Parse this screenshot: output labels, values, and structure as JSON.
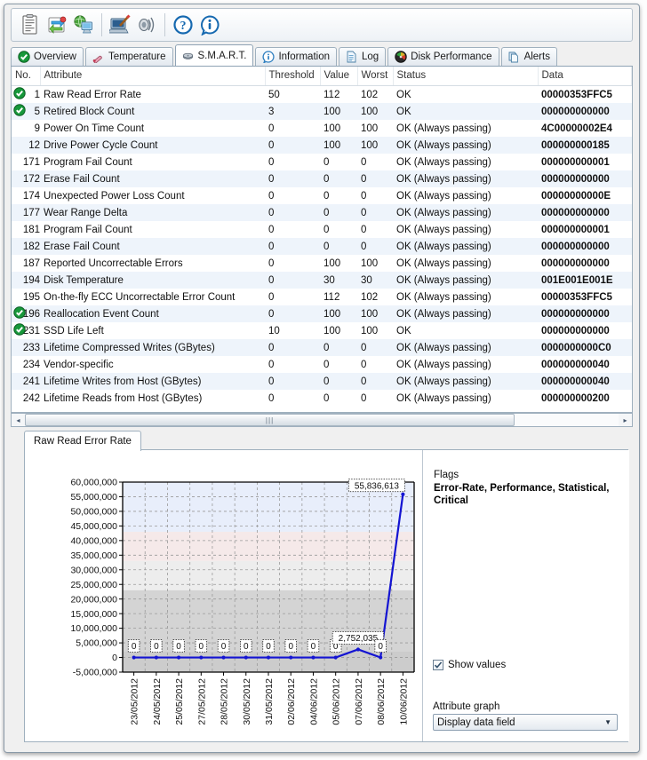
{
  "toolbar": {
    "buttons": [
      {
        "name": "report-icon",
        "title": "Report"
      },
      {
        "name": "refresh-icon",
        "title": "Refresh"
      },
      {
        "name": "network-globe-icon",
        "title": "Network"
      },
      {
        "name": "configure-disk-icon",
        "title": "Configure"
      },
      {
        "name": "sound-icon",
        "title": "Sound"
      },
      {
        "name": "help-icon",
        "title": "Help"
      },
      {
        "name": "about-info-icon",
        "title": "Information"
      }
    ]
  },
  "tabs": [
    {
      "label": "Overview",
      "icon": "green-check-icon",
      "active": false
    },
    {
      "label": "Temperature",
      "icon": "thermometer-icon",
      "active": false
    },
    {
      "label": "S.M.A.R.T.",
      "icon": "smart-chip-icon",
      "active": true
    },
    {
      "label": "Information",
      "icon": "info-icon",
      "active": false
    },
    {
      "label": "Log",
      "icon": "document-icon",
      "active": false
    },
    {
      "label": "Disk Performance",
      "icon": "gauge-icon",
      "active": false
    },
    {
      "label": "Alerts",
      "icon": "pages-icon",
      "active": false
    }
  ],
  "table": {
    "columns": [
      "No.",
      "Attribute",
      "Threshold",
      "Value",
      "Worst",
      "Status",
      "Data"
    ],
    "rows": [
      {
        "check": true,
        "no": "1",
        "attribute": "Raw Read Error Rate",
        "threshold": "50",
        "value": "112",
        "worst": "102",
        "status": "OK",
        "data": "00000353FFC5"
      },
      {
        "check": true,
        "no": "5",
        "attribute": "Retired Block Count",
        "threshold": "3",
        "value": "100",
        "worst": "100",
        "status": "OK",
        "data": "000000000000"
      },
      {
        "check": false,
        "no": "9",
        "attribute": "Power On Time Count",
        "threshold": "0",
        "value": "100",
        "worst": "100",
        "status": "OK (Always passing)",
        "data": "4C00000002E4"
      },
      {
        "check": false,
        "no": "12",
        "attribute": "Drive Power Cycle Count",
        "threshold": "0",
        "value": "100",
        "worst": "100",
        "status": "OK (Always passing)",
        "data": "000000000185"
      },
      {
        "check": false,
        "no": "171",
        "attribute": "Program Fail Count",
        "threshold": "0",
        "value": "0",
        "worst": "0",
        "status": "OK (Always passing)",
        "data": "000000000001"
      },
      {
        "check": false,
        "no": "172",
        "attribute": "Erase Fail Count",
        "threshold": "0",
        "value": "0",
        "worst": "0",
        "status": "OK (Always passing)",
        "data": "000000000000"
      },
      {
        "check": false,
        "no": "174",
        "attribute": "Unexpected Power Loss Count",
        "threshold": "0",
        "value": "0",
        "worst": "0",
        "status": "OK (Always passing)",
        "data": "00000000000E"
      },
      {
        "check": false,
        "no": "177",
        "attribute": "Wear Range Delta",
        "threshold": "0",
        "value": "0",
        "worst": "0",
        "status": "OK (Always passing)",
        "data": "000000000000"
      },
      {
        "check": false,
        "no": "181",
        "attribute": "Program Fail Count",
        "threshold": "0",
        "value": "0",
        "worst": "0",
        "status": "OK (Always passing)",
        "data": "000000000001"
      },
      {
        "check": false,
        "no": "182",
        "attribute": "Erase Fail Count",
        "threshold": "0",
        "value": "0",
        "worst": "0",
        "status": "OK (Always passing)",
        "data": "000000000000"
      },
      {
        "check": false,
        "no": "187",
        "attribute": "Reported Uncorrectable Errors",
        "threshold": "0",
        "value": "100",
        "worst": "100",
        "status": "OK (Always passing)",
        "data": "000000000000"
      },
      {
        "check": false,
        "no": "194",
        "attribute": "Disk Temperature",
        "threshold": "0",
        "value": "30",
        "worst": "30",
        "status": "OK (Always passing)",
        "data": "001E001E001E"
      },
      {
        "check": false,
        "no": "195",
        "attribute": "On-the-fly ECC Uncorrectable Error Count",
        "threshold": "0",
        "value": "112",
        "worst": "102",
        "status": "OK (Always passing)",
        "data": "00000353FFC5"
      },
      {
        "check": true,
        "no": "196",
        "attribute": "Reallocation Event Count",
        "threshold": "0",
        "value": "100",
        "worst": "100",
        "status": "OK (Always passing)",
        "data": "000000000000"
      },
      {
        "check": true,
        "no": "231",
        "attribute": "SSD Life Left",
        "threshold": "10",
        "value": "100",
        "worst": "100",
        "status": "OK",
        "data": "000000000000"
      },
      {
        "check": false,
        "no": "233",
        "attribute": "Lifetime Compressed Writes (GBytes)",
        "threshold": "0",
        "value": "0",
        "worst": "0",
        "status": "OK (Always passing)",
        "data": "0000000000C0"
      },
      {
        "check": false,
        "no": "234",
        "attribute": "Vendor-specific",
        "threshold": "0",
        "value": "0",
        "worst": "0",
        "status": "OK (Always passing)",
        "data": "000000000040"
      },
      {
        "check": false,
        "no": "241",
        "attribute": "Lifetime Writes from Host (GBytes)",
        "threshold": "0",
        "value": "0",
        "worst": "0",
        "status": "OK (Always passing)",
        "data": "000000000040"
      },
      {
        "check": false,
        "no": "242",
        "attribute": "Lifetime Reads from Host (GBytes)",
        "threshold": "0",
        "value": "0",
        "worst": "0",
        "status": "OK (Always passing)",
        "data": "000000000200"
      }
    ]
  },
  "scrollbar": {
    "left_arrow": "◂",
    "right_arrow": "▸",
    "grip": "|||"
  },
  "graph_panel": {
    "tab_label": "Raw Read Error Rate",
    "flags_label": "Flags",
    "flags_value": "Error-Rate, Performance, Statistical, Critical",
    "show_values_label": "Show values",
    "show_values_checked": true,
    "attribute_graph_label": "Attribute graph",
    "select_value": "Display data field",
    "select_arrow": "▼"
  },
  "chart_data": {
    "type": "line",
    "title": "Raw Read Error Rate",
    "xlabel": "",
    "ylabel": "",
    "grid": true,
    "legend": "none",
    "line_color": "#1414d2",
    "ylim": [
      -5000000,
      60000000
    ],
    "yticks": [
      60000000,
      55000000,
      50000000,
      45000000,
      40000000,
      35000000,
      30000000,
      25000000,
      20000000,
      15000000,
      10000000,
      5000000,
      0,
      -5000000
    ],
    "ytick_labels": [
      "60,000,000",
      "55,000,000",
      "50,000,000",
      "45,000,000",
      "40,000,000",
      "35,000,000",
      "30,000,000",
      "25,000,000",
      "20,000,000",
      "15,000,000",
      "10,000,000",
      "5,000,000",
      "0",
      "-5,000,000"
    ],
    "categories": [
      "23/05/2012",
      "24/05/2012",
      "25/05/2012",
      "27/05/2012",
      "28/05/2012",
      "30/05/2012",
      "31/05/2012",
      "02/06/2012",
      "04/06/2012",
      "05/06/2012",
      "07/06/2012",
      "08/06/2012",
      "10/06/2012"
    ],
    "values": [
      0,
      0,
      0,
      0,
      0,
      0,
      0,
      0,
      0,
      0,
      2752035,
      0,
      55836613
    ],
    "point_labels": [
      "0",
      "0",
      "0",
      "0",
      "0",
      "0",
      "0",
      "0",
      "0",
      "0",
      "2,752,035",
      "0",
      "55,836,613"
    ]
  }
}
